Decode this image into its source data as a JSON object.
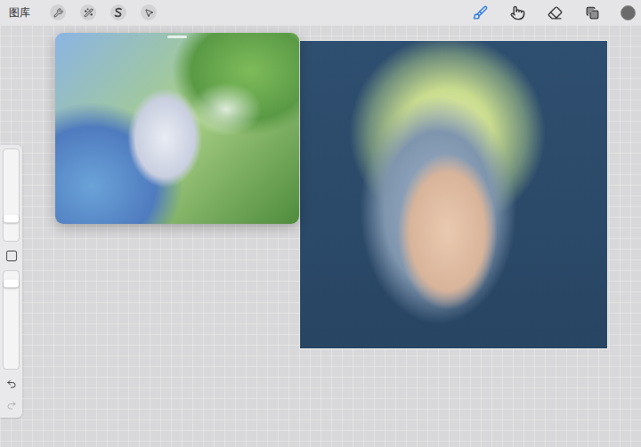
{
  "top_bar": {
    "gallery_label": "图库",
    "actions": [
      {
        "selected": false
      },
      {
        "selected": false
      },
      {
        "selected": false
      },
      {
        "selected": false
      }
    ],
    "tools": [
      {
        "selected": true
      },
      {
        "selected": false
      },
      {
        "selected": false
      }
    ],
    "layers": {
      "selected": false
    },
    "color": {
      "color": "#6b6b6b"
    }
  },
  "sidebar": {
    "brush_size": {
      "level": 0.24
    },
    "opacity": {
      "level": 0.87
    },
    "undo": {
      "disabled": false
    },
    "redo": {
      "disabled": true
    }
  },
  "reference_window": {
    "picture": true
  },
  "canvas": {
    "picture": true
  }
}
